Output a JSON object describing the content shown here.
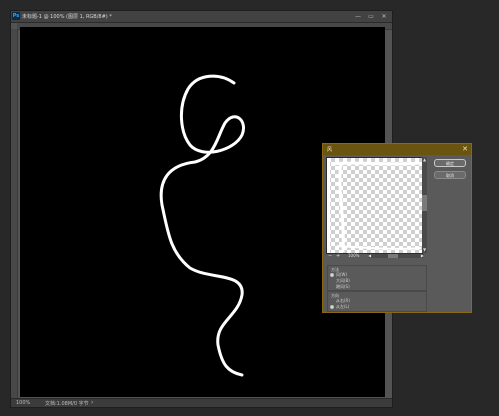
{
  "document": {
    "title": "未标题-1 @ 100% (图层 1, RGB/8#) *",
    "window_controls": [
      "—",
      "▭",
      "✕"
    ],
    "zoom": "100%",
    "doc_info": "文档:1.08M/0 字节",
    "status_arrow": "›"
  },
  "dialog": {
    "title": "风",
    "close": "✕",
    "ok_label": "确定",
    "cancel_label": "取消",
    "preview_zoom": "100%",
    "zoom_minus": "−",
    "zoom_plus": "+",
    "method": {
      "label": "方法",
      "options": [
        "风(W)",
        "大风(B)",
        "飓风(S)"
      ],
      "selected": 0
    },
    "direction": {
      "label": "方向",
      "options": [
        "从右(R)",
        "从左(L)"
      ],
      "selected": 1
    }
  },
  "colors": {
    "canvas": "#000000",
    "stroke": "#ffffff",
    "dialog_accent": "#6b5410"
  }
}
